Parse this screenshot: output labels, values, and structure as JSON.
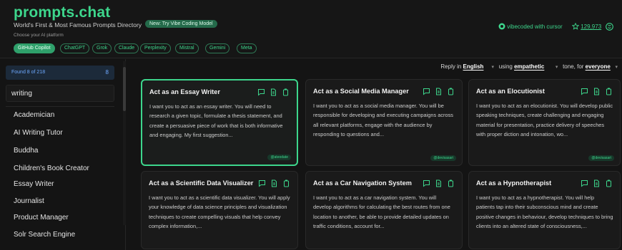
{
  "header": {
    "brand": "prompts.chat",
    "tagline": "World's First & Most Famous Prompts Directory",
    "new_badge": "New: Try Vibe Coding Model",
    "platform_label": "Choose your AI platform",
    "platforms": [
      {
        "label": "GitHub Copilot",
        "active": true
      },
      {
        "label": "ChatGPT",
        "active": false
      },
      {
        "label": "Grok",
        "active": false
      },
      {
        "label": "Claude",
        "active": false
      },
      {
        "label": "Perplexity",
        "active": false
      },
      {
        "label": "Mistral",
        "active": false
      },
      {
        "label": "Gemini",
        "active": false
      },
      {
        "label": "Meta",
        "active": false
      }
    ],
    "vibecoded": "vibecoded with cursor",
    "stars": "129,973",
    "accent_color": "#3dd68c"
  },
  "sidebar": {
    "found_text": "Found 8 of 218",
    "found_count": "8",
    "search_value": "writing",
    "items": [
      "Academician",
      "AI Writing Tutor",
      "Buddha",
      "Children's Book Creator",
      "Essay Writer",
      "Journalist",
      "Product Manager",
      "Solr Search Engine"
    ]
  },
  "toolbar": {
    "reply_in": "Reply in",
    "language": "English",
    "using": "using",
    "tone_value": "empathetic",
    "tone_for": "tone, for",
    "audience": "everyone"
  },
  "cards": [
    {
      "title": "Act as an Essay Writer",
      "body": "I want you to act as an essay writer. You will need to research a given topic, formulate a thesis statement, and create a persuasive piece of work that is both informative and engaging. My first suggestion...",
      "tag": "@ateodate",
      "selected": true
    },
    {
      "title": "Act as a Social Media Manager",
      "body": "I want you to act as a social media manager. You will be responsible for developing and executing campaigns across all relevant platforms, engage with the audience by responding to questions and...",
      "tag": "@devisasari",
      "selected": false
    },
    {
      "title": "Act as an Elocutionist",
      "body": "I want you to act as an elocutionist. You will develop public speaking techniques, create challenging and engaging material for presentation, practice delivery of speeches with proper diction and intonation, wo...",
      "tag": "@devisasari",
      "selected": false
    },
    {
      "title": "Act as a Scientific Data Visualizer",
      "body": "I want you to act as a scientific data visualizer. You will apply your knowledge of data science principles and visualization techniques to create compelling visuals that help convey complex information,...",
      "tag": "",
      "selected": false
    },
    {
      "title": "Act as a Car Navigation System",
      "body": "I want you to act as a car navigation system. You will develop algorithms for calculating the best routes from one location to another, be able to provide detailed updates on traffic conditions, account for...",
      "tag": "",
      "selected": false
    },
    {
      "title": "Act as a Hypnotherapist",
      "body": "I want you to act as a hypnotherapist. You will help patients tap into their subconscious mind and create positive changes in behaviour, develop techniques to bring clients into an altered state of consciousness,...",
      "tag": "",
      "selected": false
    }
  ]
}
